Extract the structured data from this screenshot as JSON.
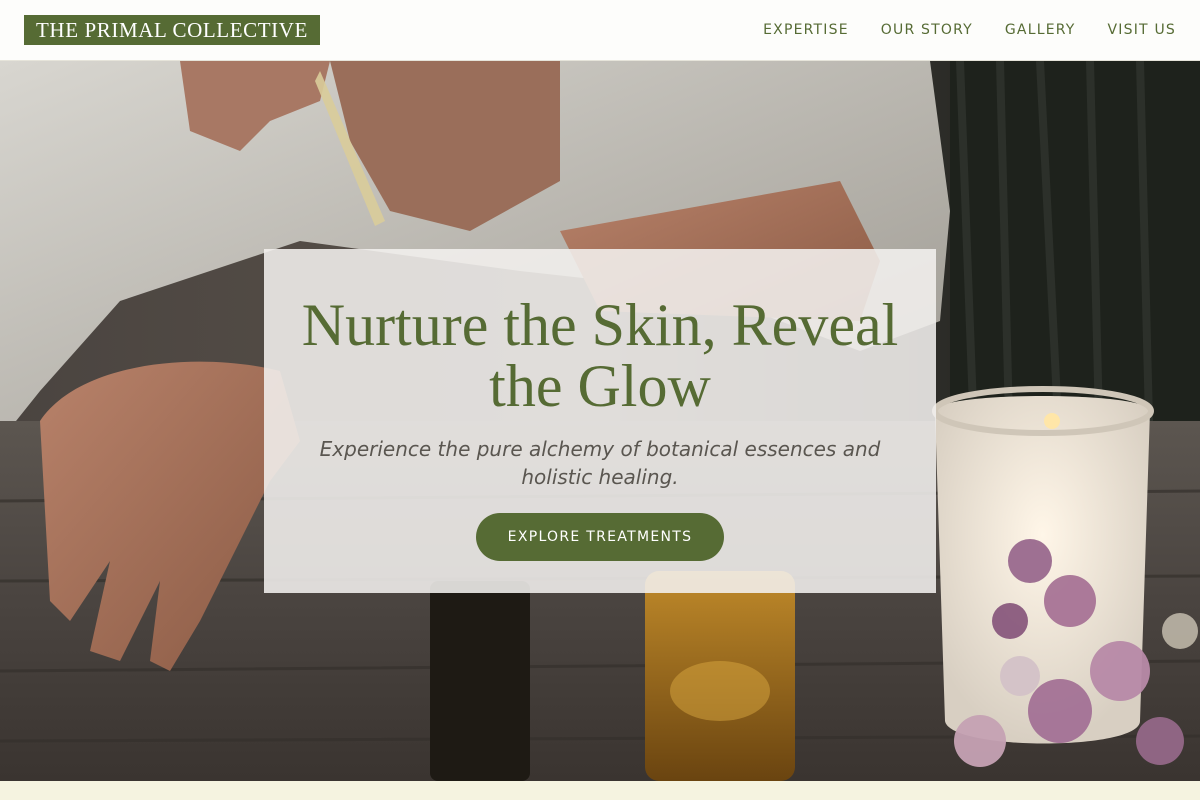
{
  "brand": {
    "logo_text": "THE PRIMAL COLLECTIVE"
  },
  "nav": {
    "items": [
      {
        "label": "EXPERTISE"
      },
      {
        "label": "OUR STORY"
      },
      {
        "label": "GALLERY"
      },
      {
        "label": "VISIT US"
      }
    ]
  },
  "hero": {
    "title": "Nurture the Skin, Reveal the Glow",
    "subtitle": "Experience the pure alchemy of botanical essences and holistic healing.",
    "cta_label": "EXPLORE TREATMENTS"
  },
  "colors": {
    "accent": "#566b34",
    "nav_bg": "#fdfdfb",
    "card_bg": "rgba(242,240,238,0.88)",
    "page_bg": "#f5f3e0"
  }
}
